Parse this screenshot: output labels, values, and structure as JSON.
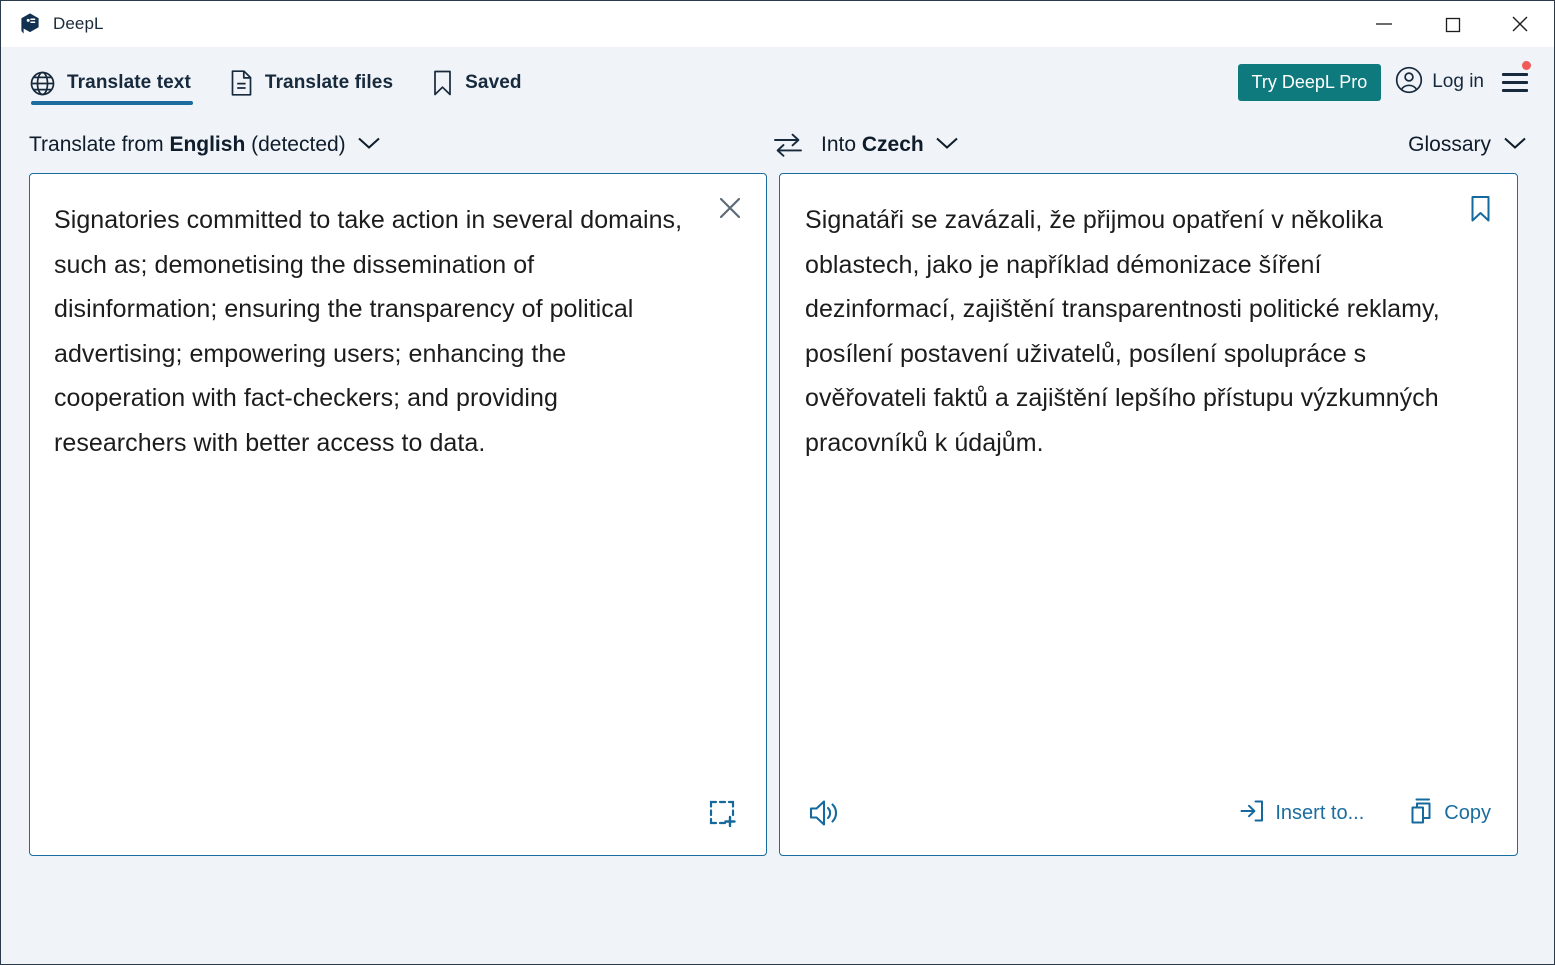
{
  "window": {
    "title": "DeepL",
    "logo_icon": "deepl-logo-icon",
    "controls": {
      "minimize": "minimize-icon",
      "maximize": "maximize-icon",
      "close": "close-icon"
    }
  },
  "nav": {
    "tabs": [
      {
        "label": "Translate text",
        "icon": "globe-icon",
        "active": true
      },
      {
        "label": "Translate files",
        "icon": "document-icon",
        "active": false
      },
      {
        "label": "Saved",
        "icon": "bookmark-icon",
        "active": false
      }
    ],
    "pro_button": "Try DeepL Pro",
    "login_label": "Log in",
    "login_icon": "account-circle-icon",
    "menu_icon": "hamburger-menu-icon",
    "menu_has_notification": true
  },
  "language_bar": {
    "source_prefix": "Translate from ",
    "source_language": "English",
    "source_suffix": " (detected)",
    "swap_icon": "swap-languages-icon",
    "target_prefix": "Into ",
    "target_language": "Czech",
    "glossary_label": "Glossary",
    "chevron_icon": "chevron-down-icon"
  },
  "source_panel": {
    "text": "Signatories committed to take action in several domains, such as; demonetising the dissemination of disinformation; ensuring the transparency of political advertising; empowering users; enhancing the cooperation with fact-checkers; and providing researchers with better access to data.",
    "clear_icon": "close-icon",
    "capture_icon": "select-area-icon"
  },
  "target_panel": {
    "text": "Signatáři se zavázali, že přijmou opatření v několika oblastech, jako je například démonizace šíření dezinformací, zajištění transparentnosti politické reklamy, posílení postavení uživatelů, posílení spolupráce s ověřovateli faktů a zajištění lepšího přístupu výzkumných pracovníků k údajům.",
    "bookmark_icon": "bookmark-outline-icon",
    "speak_icon": "speaker-icon",
    "insert_label": "Insert to...",
    "insert_icon": "insert-arrow-icon",
    "copy_label": "Copy",
    "copy_icon": "copy-icon"
  },
  "colors": {
    "accent_blue": "#1a6d9e",
    "pro_teal": "#0f7a7e",
    "text_dark": "#16293d",
    "notification_red": "#f05a5a",
    "app_background": "#f0f3f7"
  }
}
